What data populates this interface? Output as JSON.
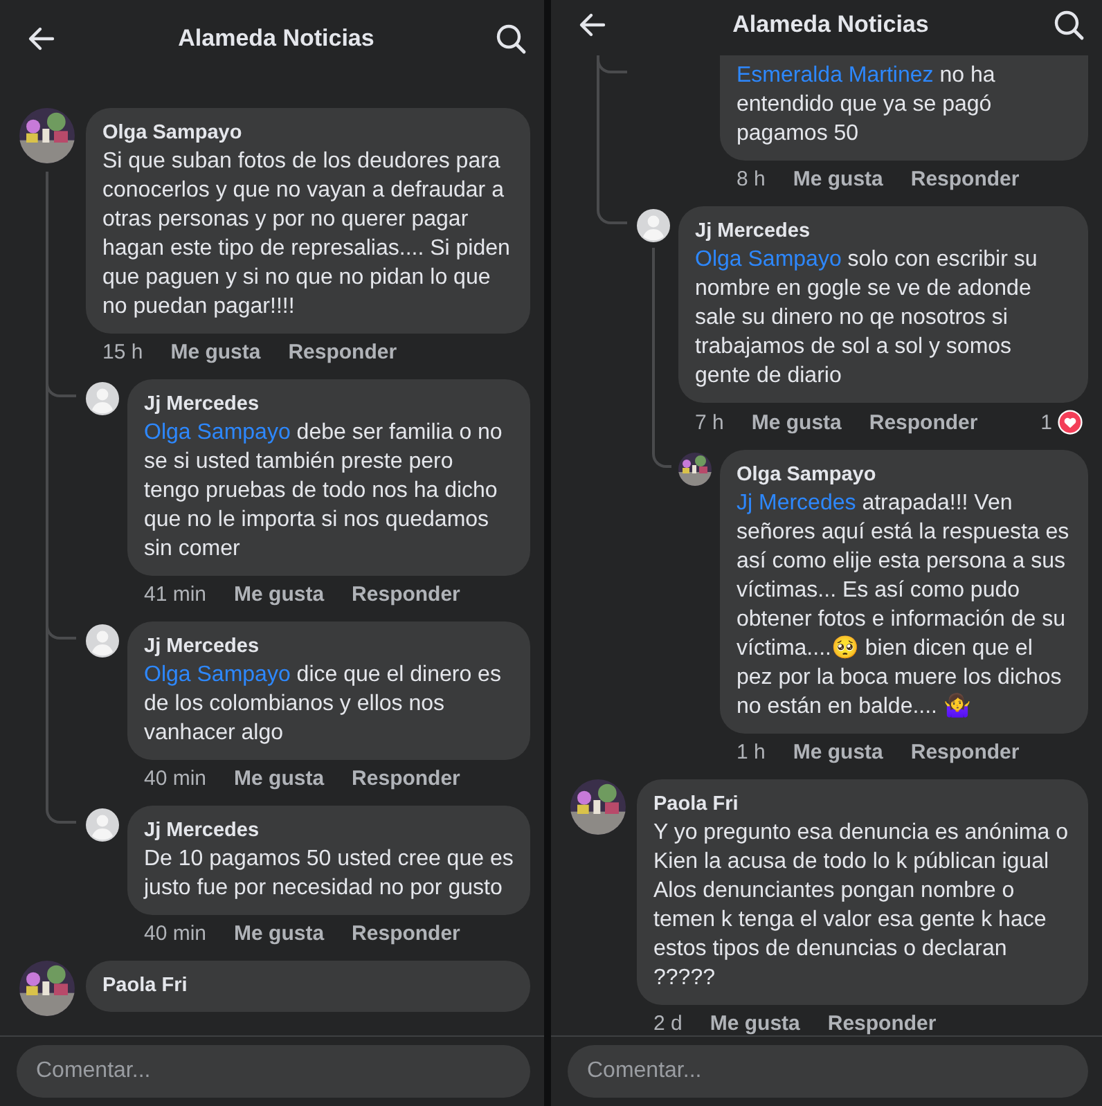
{
  "panels": [
    {
      "title": "Alameda Noticias",
      "composer": {
        "placeholder": "Comentar..."
      },
      "comments": [
        {
          "author": "Olga Sampayo",
          "text": "Si que suban fotos de los deudores para conocerlos y que no vayan a defraudar a otras personas y por no querer pagar hagan este tipo de represalias.... Si piden que paguen y si no que no pidan lo que no puedan pagar!!!!",
          "time": "15 h",
          "like": "Me gusta",
          "reply": "Responder",
          "children": [
            {
              "author": "Jj Mercedes",
              "avatar": {
                "kind": "default"
              },
              "mention": "Olga Sampayo",
              "text": "debe ser familia o no se si usted también preste pero tengo pruebas de todo nos ha dicho que no le importa si nos quedamos sin comer",
              "time": "41 min",
              "like": "Me gusta",
              "reply": "Responder"
            },
            {
              "author": "Jj Mercedes",
              "avatar": {
                "kind": "default"
              },
              "mention": "Olga Sampayo",
              "text": "dice que el dinero es de los colombianos y ellos nos vanhacer algo",
              "time": "40 min",
              "like": "Me gusta",
              "reply": "Responder"
            },
            {
              "author": "Jj Mercedes",
              "avatar": {
                "kind": "default"
              },
              "text": "De 10 pagamos 50 usted cree que es justo fue por necesidad no por gusto",
              "time": "40 min",
              "like": "Me gusta",
              "reply": "Responder"
            }
          ]
        },
        {
          "author": "Paola Fri"
        }
      ]
    },
    {
      "title": "Alameda Noticias",
      "composer": {
        "placeholder": "Comentar..."
      },
      "comments": [
        {
          "children": [
            {
              "children": [
                {
                  "mention": "Esmeralda Martinez",
                  "text": "no ha entendido que ya se pagó pagamos 50",
                  "time": "8 h",
                  "like": "Me gusta",
                  "reply": "Responder"
                }
              ]
            },
            {
              "author": "Jj Mercedes",
              "avatar": {
                "kind": "default"
              },
              "mention": "Olga Sampayo",
              "text": "solo con escribir su nombre en gogle se ve de adonde sale su dinero no qe nosotros si trabajamos de sol a sol y somos gente de diario",
              "time": "7 h",
              "like": "Me gusta",
              "reply": "Responder",
              "reaction_count": "1",
              "children": [
                {
                  "author": "Olga Sampayo",
                  "mention": "Jj Mercedes",
                  "text": "atrapada!!! Ven señores aquí está la respuesta es así como elije esta persona a sus víctimas... Es así como pudo obtener fotos e información de su víctima....🥺 bien dicen que el pez por la boca muere los dichos no están en balde.... 🤷‍♀️",
                  "time": "1 h",
                  "like": "Me gusta",
                  "reply": "Responder"
                }
              ]
            }
          ]
        },
        {
          "author": "Paola Fri",
          "text": "Y yo pregunto esa denuncia es anónima o Kien la acusa de todo lo k públican igual Alos denunciantes pongan nombre o temen k tenga el valor esa gente k hace estos tipos de denuncias o declaran ?????",
          "time": "2 d",
          "like": "Me gusta",
          "reply": "Responder"
        }
      ]
    }
  ]
}
